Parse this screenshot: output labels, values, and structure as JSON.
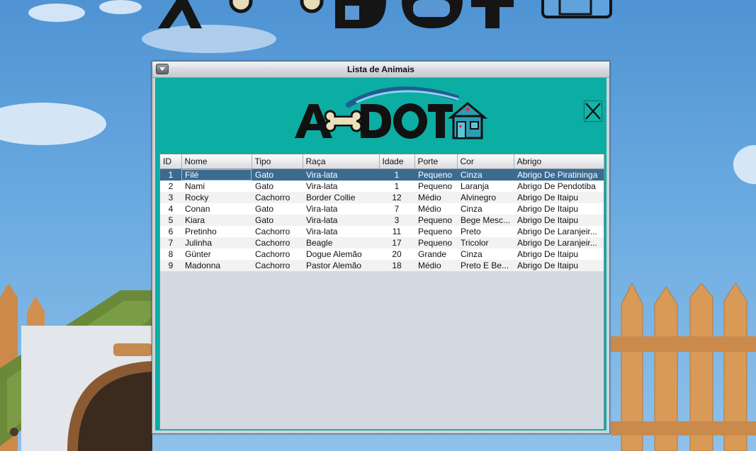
{
  "window": {
    "title": "Lista de Animais"
  },
  "table": {
    "columns": [
      "ID",
      "Nome",
      "Tipo",
      "Raça",
      "Idade",
      "Porte",
      "Cor",
      "Abrigo"
    ],
    "rows": [
      [
        "1",
        "Filé",
        "Gato",
        "Vira-lata",
        "1",
        "Pequeno",
        "Cinza",
        "Abrigo De Piratininga"
      ],
      [
        "2",
        "Nami",
        "Gato",
        "Vira-lata",
        "1",
        "Pequeno",
        "Laranja",
        "Abrigo De Pendotiba"
      ],
      [
        "3",
        "Rocky",
        "Cachorro",
        "Border Collie",
        "12",
        "Médio",
        "Alvinegro",
        "Abrigo De Itaipu"
      ],
      [
        "4",
        "Conan",
        "Gato",
        "Vira-lata",
        "7",
        "Médio",
        "Cinza",
        "Abrigo De Itaipu"
      ],
      [
        "5",
        "Kiara",
        "Gato",
        "Vira-lata",
        "3",
        "Pequeno",
        "Bege Mesc...",
        "Abrigo De Itaipu"
      ],
      [
        "6",
        "Pretinho",
        "Cachorro",
        "Vira-lata",
        "11",
        "Pequeno",
        "Preto",
        "Abrigo De Laranjeir..."
      ],
      [
        "7",
        "Julinha",
        "Cachorro",
        "Beagle",
        "17",
        "Pequeno",
        "Tricolor",
        "Abrigo De Laranjeir..."
      ],
      [
        "8",
        "Günter",
        "Cachorro",
        "Dogue Alemão",
        "20",
        "Grande",
        "Cinza",
        "Abrigo De Itaipu"
      ],
      [
        "9",
        "Madonna",
        "Cachorro",
        "Pastor Alemão",
        "18",
        "Médio",
        "Preto E Be...",
        "Abrigo De Itaipu"
      ]
    ],
    "selected_row": 0
  },
  "colors": {
    "content_bg": "#0cada3",
    "selection": "#3c6b90",
    "table_empty_bg": "#d4d9e1"
  },
  "icons": {
    "window_menu": "chevron-down-icon",
    "close": "close-icon",
    "logo_bone": "bone-icon",
    "logo_house": "house-icon"
  }
}
